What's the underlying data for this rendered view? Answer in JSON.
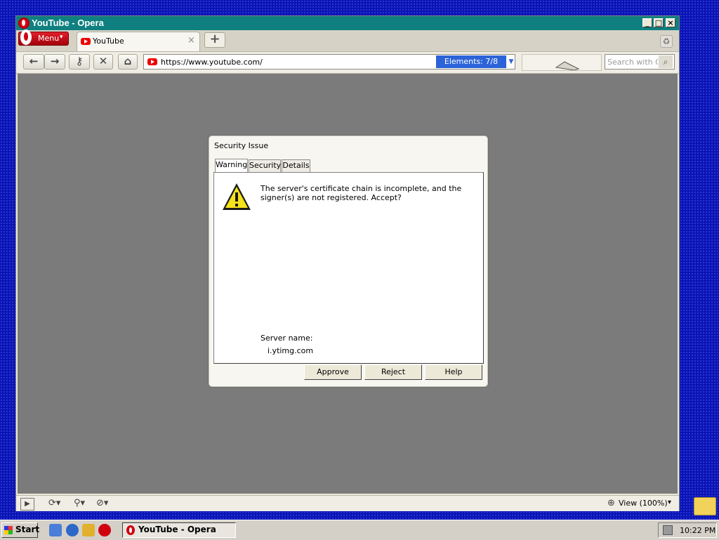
{
  "window": {
    "title": "YouTube - Opera",
    "controls": {
      "minimize": "_",
      "maximize": "□",
      "close": "×"
    }
  },
  "tabstrip": {
    "menu_label": "Menu",
    "menu_caret": "▾",
    "tabs": [
      {
        "title": "YouTube",
        "close": "×"
      }
    ],
    "new_tab": "+"
  },
  "toolbar": {
    "back": "←",
    "forward": "→",
    "key": "⚷",
    "stop": "✕",
    "home": "⌂",
    "address": "https://www.youtube.com/",
    "elements_badge": "Elements:   7/8",
    "dropdown": "▼",
    "search_placeholder": "Search with C",
    "search_go": "⌕"
  },
  "dialog": {
    "title": "Security Issue",
    "tabs": [
      "Warning",
      "Security",
      "Details"
    ],
    "message": "The server's certificate chain is incomplete, and the signer(s) are not registered. Accept?",
    "server_name_label": "Server name:",
    "server_name_value": "i.ytimg.com",
    "buttons": {
      "approve": "Approve",
      "reject": "Reject",
      "help": "Help"
    }
  },
  "statusbar": {
    "zoom": "View (100%)",
    "zoom_caret": "▾"
  },
  "taskbar": {
    "start": "Start",
    "task": "YouTube - Opera",
    "clock": "10:22 PM"
  },
  "icons": {
    "warning": "warning-triangle-icon",
    "trash": "trash-icon",
    "folder": "folder-icon"
  }
}
